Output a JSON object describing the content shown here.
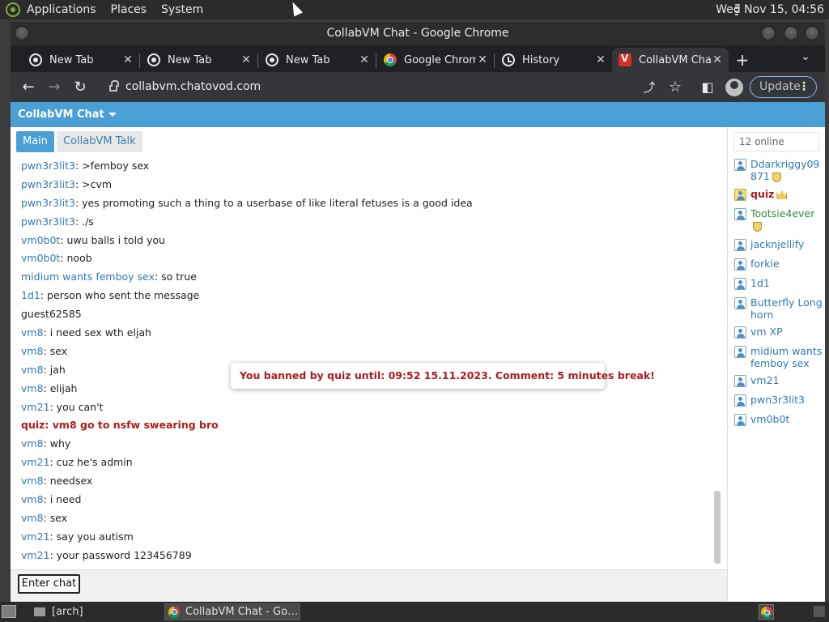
{
  "top_panel": {
    "menus": [
      "Applications",
      "Places",
      "System"
    ],
    "clock": "Wed Nov 15, 04:56"
  },
  "window": {
    "title": "CollabVM Chat - Google Chrome"
  },
  "tabs": [
    {
      "title": "New Tab",
      "icon": "new-tab-icon",
      "close": "✕"
    },
    {
      "title": "New Tab",
      "icon": "new-tab-icon",
      "close": "✕"
    },
    {
      "title": "New Tab",
      "icon": "new-tab-icon",
      "close": "✕"
    },
    {
      "title": "Google Chrom",
      "icon": "chrome-icon",
      "close": "✕"
    },
    {
      "title": "History",
      "icon": "history-icon",
      "close": "✕"
    },
    {
      "title": "CollabVM Cha",
      "icon": "collabvm-icon",
      "close": "✕",
      "active": true
    }
  ],
  "toolbar": {
    "url": "collabvm.chatovod.com",
    "update_label": "Update",
    "back_glyph": "←",
    "forward_glyph": "→",
    "reload_glyph": "↻",
    "share_glyph": "⤴",
    "star_glyph": "☆",
    "sidebar_glyph": "◧",
    "menu_glyph": "⋮",
    "newtab_glyph": "+",
    "tabsearch_glyph": "⌄"
  },
  "page": {
    "header": "CollabVM Chat",
    "chat_tabs": [
      "Main",
      "CollabVM Talk"
    ],
    "messages": [
      {
        "user": "pwn3r3lit3",
        "text": ": >femboy sex"
      },
      {
        "user": "pwn3r3lit3",
        "text": ": >cvm"
      },
      {
        "user": "pwn3r3lit3",
        "text": ": yes promoting such a thing to a userbase of like literal fetuses is a good idea"
      },
      {
        "user": "pwn3r3lit3",
        "text": ": ./s"
      },
      {
        "user": "vm0b0t",
        "text": ": uwu balls i told you"
      },
      {
        "user": "vm0b0t",
        "text": ": noob"
      },
      {
        "user": "midium wants femboy sex",
        "text": ": so true"
      },
      {
        "user": "1d1",
        "text": ": person who sent the message"
      },
      {
        "user": "",
        "text": "guest62585",
        "style": "plain"
      },
      {
        "user": "vm8",
        "text": ": i need sex wth eljah"
      },
      {
        "user": "vm8",
        "text": ": sex"
      },
      {
        "user": "vm8",
        "text": ": jah"
      },
      {
        "user": "vm8",
        "text": ": elijah"
      },
      {
        "user": "vm21",
        "text": ": you can't"
      },
      {
        "user": "quiz",
        "text": ": vm8 go to nsfw swearing bro",
        "style": "admin"
      },
      {
        "user": "vm8",
        "text": ": why"
      },
      {
        "user": "vm21",
        "text": ": cuz he's admin"
      },
      {
        "user": "vm8",
        "text": ": needsex"
      },
      {
        "user": "vm8",
        "text": ": i need"
      },
      {
        "user": "vm8",
        "text": ": sex"
      },
      {
        "user": "vm21",
        "text": ": say you autism"
      },
      {
        "user": "vm21",
        "text": ": your password 123456789"
      }
    ],
    "ban_notice": "You banned by quiz until: 09:52 15.11.2023. Comment: 5 minutes break!",
    "enter_chat": "Enter chat",
    "online_count": "12 online",
    "users": [
      {
        "name": "Ddarkriggy09871",
        "badge": "shield",
        "style": "mod"
      },
      {
        "name": "quiz",
        "badge": "crown",
        "style": "admin"
      },
      {
        "name": "Tootsie4ever",
        "badge": "shield",
        "style": "green"
      },
      {
        "name": "jacknjellify",
        "style": "mod"
      },
      {
        "name": "forkie",
        "style": "mod"
      },
      {
        "name": "1d1",
        "style": "mod"
      },
      {
        "name": "Butterfly Longhorn",
        "style": "mod"
      },
      {
        "name": "vm XP",
        "style": "mod"
      },
      {
        "name": "midium wants femboy sex",
        "style": "mod"
      },
      {
        "name": "vm21",
        "style": "mod"
      },
      {
        "name": "pwn3r3lit3",
        "style": "mod"
      },
      {
        "name": "vm0b0t",
        "style": "mod"
      }
    ]
  },
  "taskbar": {
    "items": [
      "[arch]",
      "CollabVM Chat - Go…"
    ]
  }
}
